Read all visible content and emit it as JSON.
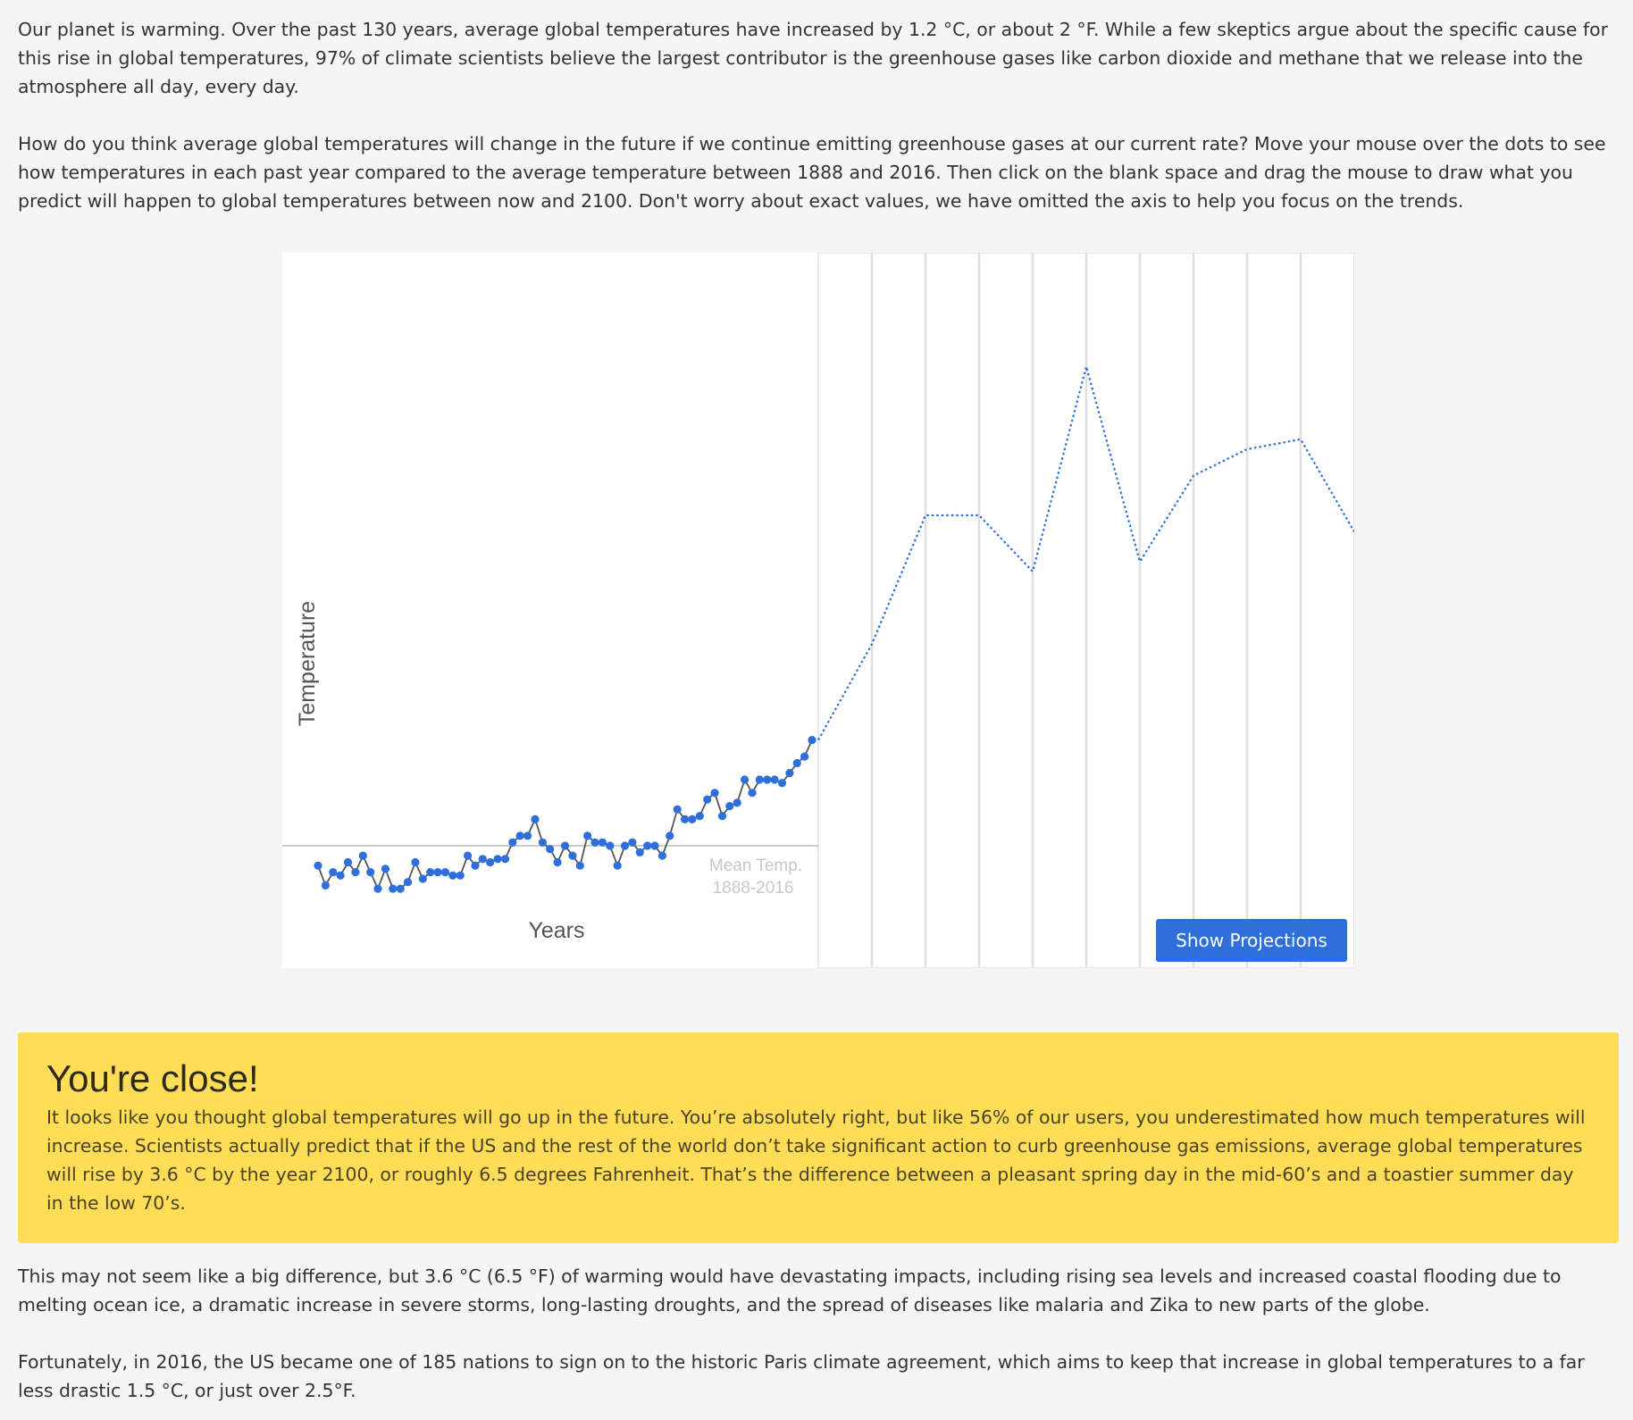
{
  "intro": {
    "p1": "Our planet is warming. Over the past 130 years, average global temperatures have increased by 1.2 °C, or about 2 °F. While a few skeptics argue about the specific cause for this rise in global temperatures, 97% of climate scientists believe the largest contributor is the greenhouse gases like carbon dioxide and methane that we release into the atmosphere all day, every day.",
    "p2": "How do you think average global temperatures will change in the future if we continue emitting greenhouse gases at our current rate? Move your mouse over the dots to see how temperatures in each past year compared to the average temperature between 1888 and 2016. Then click on the blank space and drag the mouse to draw what you predict will happen to global temperatures between now and 2100. Don't worry about exact values, we have omitted the axis to help you focus on the trends."
  },
  "chart_data": {
    "type": "line",
    "xlabel": "Years",
    "ylabel": "Temperature",
    "mean_label_line1": "Mean Temp.",
    "mean_label_line2": "1888-2016",
    "mean_value": 0,
    "ylim": [
      -0.4,
      1.5
    ],
    "historical_x_range": [
      1888,
      2016
    ],
    "historical": [
      -0.06,
      -0.12,
      -0.08,
      -0.09,
      -0.05,
      -0.08,
      -0.03,
      -0.08,
      -0.13,
      -0.07,
      -0.13,
      -0.13,
      -0.11,
      -0.05,
      -0.1,
      -0.08,
      -0.08,
      -0.08,
      -0.09,
      -0.09,
      -0.03,
      -0.06,
      -0.04,
      -0.05,
      -0.04,
      -0.04,
      0.01,
      0.03,
      0.03,
      0.08,
      0.01,
      -0.01,
      -0.05,
      0.0,
      -0.03,
      -0.06,
      0.03,
      0.01,
      0.01,
      0.0,
      -0.06,
      0.0,
      0.01,
      -0.02,
      0.0,
      0.0,
      -0.03,
      0.03,
      0.11,
      0.08,
      0.08,
      0.09,
      0.14,
      0.16,
      0.09,
      0.12,
      0.13,
      0.2,
      0.16,
      0.2,
      0.2,
      0.2,
      0.19,
      0.22,
      0.25,
      0.27,
      0.32
    ],
    "prediction_x_range": [
      2016,
      2100
    ],
    "prediction": [
      0.32,
      0.61,
      1.0,
      1.0,
      0.83,
      1.45,
      0.86,
      1.12,
      1.2,
      1.23,
      0.95
    ]
  },
  "button": {
    "show_projections": "Show Projections"
  },
  "feedback": {
    "title": "You're close!",
    "body": "It looks like you thought global temperatures will go up in the future. You’re absolutely right, but like 56% of our users, you underestimated how much temperatures will increase. Scientists actually predict that if the US and the rest of the world don’t take significant action to curb greenhouse gas emissions, average global temperatures will rise by 3.6 °C by the year 2100, or roughly 6.5 degrees Fahrenheit. That’s the difference between a pleasant spring day in the mid-60’s and a toastier summer day in the low 70’s."
  },
  "outro": {
    "p3": "This may not seem like a big difference, but 3.6 °C (6.5 °F) of warming would have devastating impacts, including rising sea levels and increased coastal flooding due to melting ocean ice, a dramatic increase in severe storms, long-lasting droughts, and the spread of diseases like malaria and Zika to new parts of the globe.",
    "p4": "Fortunately, in 2016, the US became one of 185 nations to sign on to the historic Paris climate agreement, which aims to keep that increase in global temperatures to a far less drastic 1.5 °C, or just over 2.5°F."
  },
  "colors": {
    "accent": "#2f6fdc",
    "dot": "#2f6fdc",
    "history_line": "#555555",
    "mean_line": "#cccccc",
    "feedback_bg": "#ffdd57"
  }
}
